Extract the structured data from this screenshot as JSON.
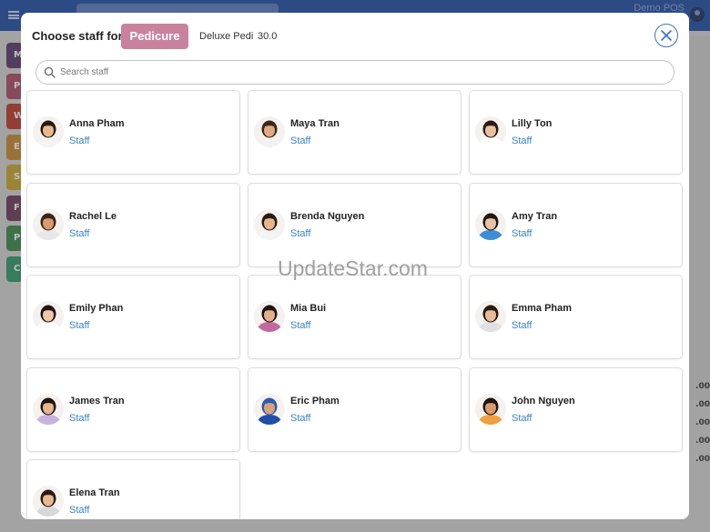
{
  "app": {
    "title": "Demo POS"
  },
  "background": {
    "tiles": [
      {
        "letter": "M",
        "color": "#5b3a6e"
      },
      {
        "letter": "P",
        "color": "#b04a6a"
      },
      {
        "letter": "W",
        "color": "#c0392b"
      },
      {
        "letter": "E",
        "color": "#c98a2e"
      },
      {
        "letter": "S",
        "color": "#c9a62e"
      },
      {
        "letter": "F",
        "color": "#6e3a5b"
      },
      {
        "letter": "P",
        "color": "#3a8a4a"
      },
      {
        "letter": "C",
        "color": "#2e9a6a"
      }
    ],
    "right_values": [
      ".00",
      ".00",
      ".00",
      ".00",
      ".00"
    ]
  },
  "modal": {
    "header_label": "Choose staff for:",
    "service_chip": "Pedicure",
    "service_name": "Deluxe Pedi",
    "service_price": "30.0",
    "close_icon": "close-icon",
    "search": {
      "placeholder": "Search staff",
      "value": ""
    },
    "staff": [
      {
        "name": "Anna Pham",
        "role": "Staff",
        "skin": "#e8b98f",
        "hair": "#2a1a12",
        "shirt": "#f4f4f4"
      },
      {
        "name": "Maya Tran",
        "role": "Staff",
        "skin": "#e0aa84",
        "hair": "#3a2618",
        "shirt": "#f2f2f2"
      },
      {
        "name": "Lilly Ton",
        "role": "Staff",
        "skin": "#e8c0a0",
        "hair": "#2a1a12",
        "shirt": "#ffffff"
      },
      {
        "name": "Rachel Le",
        "role": "Staff",
        "skin": "#d99a6c",
        "hair": "#3a2418",
        "shirt": "#e8e8e8"
      },
      {
        "name": "Brenda Nguyen",
        "role": "Staff",
        "skin": "#e6b58e",
        "hair": "#2a1a12",
        "shirt": "#f4f4f4"
      },
      {
        "name": "Amy Tran",
        "role": "Staff",
        "skin": "#e8c2a2",
        "hair": "#1e1410",
        "shirt": "#3b8ed6"
      },
      {
        "name": "Emily Phan",
        "role": "Staff",
        "skin": "#efc7a6",
        "hair": "#1e1410",
        "shirt": "#ffffff"
      },
      {
        "name": "Mia Bui",
        "role": "Staff",
        "skin": "#e2b08c",
        "hair": "#1e1410",
        "shirt": "#c26aa0"
      },
      {
        "name": "Emma Pham",
        "role": "Staff",
        "skin": "#e6bb98",
        "hair": "#2a1a12",
        "shirt": "#e0e0e0"
      },
      {
        "name": "James Tran",
        "role": "Staff",
        "skin": "#e6b48e",
        "hair": "#1e1410",
        "shirt": "#c7b2e0"
      },
      {
        "name": "Eric Pham",
        "role": "Staff",
        "skin": "#d9a27a",
        "hair": "#2a5db0",
        "shirt": "#1f4fa8"
      },
      {
        "name": "John Nguyen",
        "role": "Staff",
        "skin": "#d99a6c",
        "hair": "#1e1410",
        "shirt": "#f0a040"
      },
      {
        "name": "Elena Tran",
        "role": "Staff",
        "skin": "#e8b98f",
        "hair": "#2a1a12",
        "shirt": "#d8d8d8"
      }
    ]
  },
  "watermark": "UpdateStar.com"
}
